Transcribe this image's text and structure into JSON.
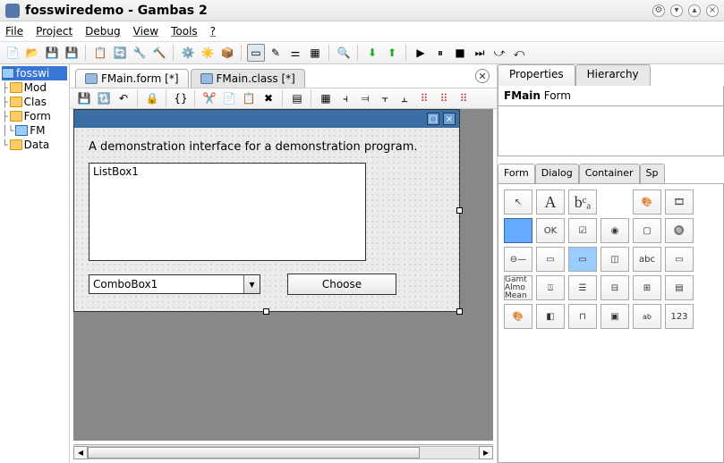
{
  "window": {
    "title": "fosswiredemo - Gambas 2"
  },
  "menu": {
    "file": "File",
    "project": "Project",
    "debug": "Debug",
    "view": "View",
    "tools": "Tools",
    "help": "?"
  },
  "tree": {
    "root": "fosswi",
    "items": [
      "Mod",
      "Clas",
      "Form",
      "FM",
      "Data"
    ]
  },
  "tabs": {
    "form": "FMain.form [*]",
    "class": "FMain.class [*]"
  },
  "designer": {
    "label_text": "A demonstration interface for a demonstration program.",
    "listbox_text": "ListBox1",
    "combo_text": "ComboBox1",
    "button_text": "Choose"
  },
  "props": {
    "tab_properties": "Properties",
    "tab_hierarchy": "Hierarchy",
    "selected_name": "FMain",
    "selected_type": "Form"
  },
  "toolbox": {
    "tabs": {
      "form": "Form",
      "dialog": "Dialog",
      "container": "Container",
      "sp": "Sp"
    },
    "items": {
      "A": "A",
      "bca": "bᶜₐ",
      "OK": "OK",
      "abc": "abc",
      "num": "123",
      "gamt": "Gamt\nAlmo\nMean"
    }
  }
}
